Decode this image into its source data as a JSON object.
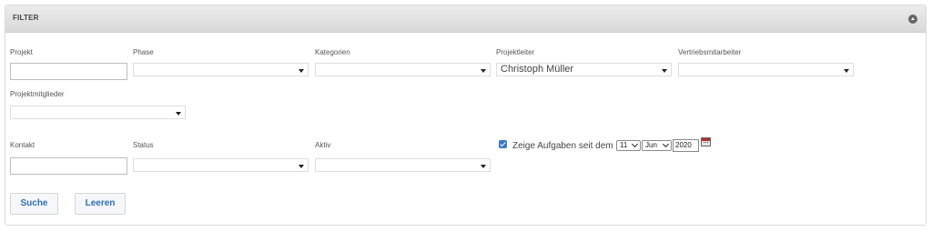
{
  "panel": {
    "title": "FILTER"
  },
  "fields": {
    "projekt": {
      "label": "Projekt",
      "value": ""
    },
    "phase": {
      "label": "Phase",
      "value": ""
    },
    "kategorien": {
      "label": "Kategorien",
      "value": ""
    },
    "projektleiter": {
      "label": "Projektleiter",
      "value": "Christoph Müller"
    },
    "vertriebsmitarbeiter": {
      "label": "Vertriebsmitarbeiter",
      "value": ""
    },
    "projektmitglieder": {
      "label": "Projektmitglieder",
      "value": ""
    },
    "kontakt": {
      "label": "Kontakt",
      "value": ""
    },
    "status": {
      "label": "Status",
      "value": ""
    },
    "aktiv": {
      "label": "Aktiv",
      "value": ""
    }
  },
  "tasks_filter": {
    "checked": true,
    "label": "Zeige Aufgaben seit dem",
    "day": "11",
    "month": "Jun",
    "year": "2020"
  },
  "buttons": {
    "search": "Suche",
    "clear": "Leeren"
  },
  "icons": {
    "collapse": "collapse-up-icon",
    "calendar": "calendar-icon",
    "checkbox": "checkbox-checked-icon"
  },
  "colors": {
    "accent": "#3a78c9",
    "button_text": "#2f6fb5",
    "header_bg": "#e0e0e0"
  }
}
